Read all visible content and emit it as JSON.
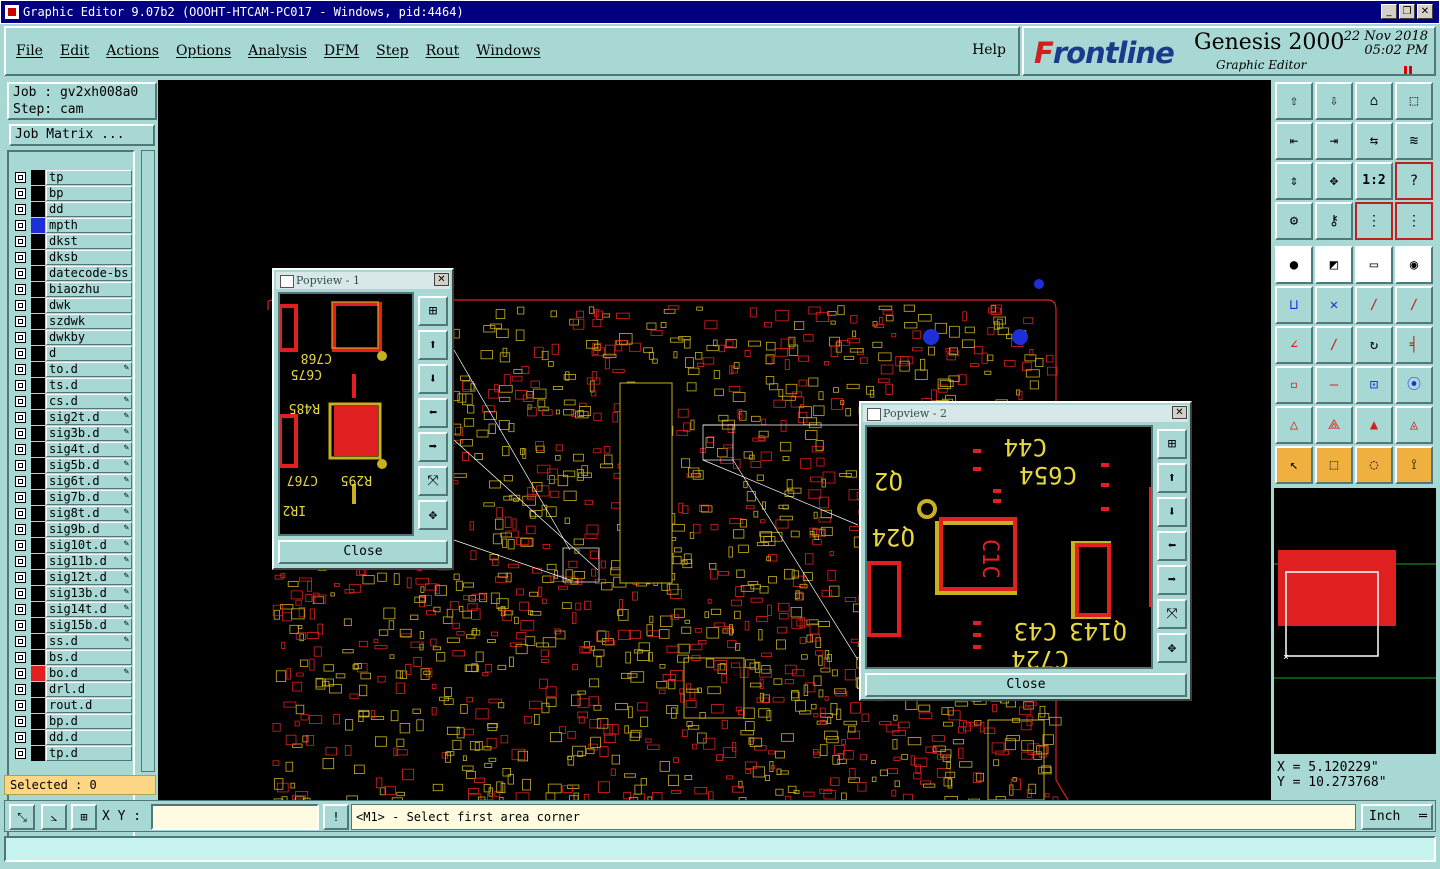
{
  "window": {
    "title": "Graphic Editor 9.07b2 (OOOHT-HTCAM-PC017 - Windows, pid:4464)"
  },
  "menu": [
    "File",
    "Edit",
    "Actions",
    "Options",
    "Analysis",
    "DFM",
    "Step",
    "Rout",
    "Windows"
  ],
  "help_label": "Help",
  "brand": {
    "logo_pre": "F",
    "logo_rest": "rontline",
    "product": "Genesis 2000",
    "subtitle": "Graphic Editor",
    "date": "22 Nov 2018",
    "time": "05:02 PM"
  },
  "job": {
    "job_line": "Job : gv2xh008a0",
    "step_line": "Step: cam",
    "matrix_label": "Job Matrix ..."
  },
  "layers": [
    {
      "name": "tp",
      "color": "#000000",
      "edit": ""
    },
    {
      "name": "bp",
      "color": "#000000",
      "edit": ""
    },
    {
      "name": "dd",
      "color": "#000000",
      "edit": ""
    },
    {
      "name": "mpth",
      "color": "#1f2fd8",
      "edit": ""
    },
    {
      "name": "dkst",
      "color": "#000000",
      "edit": ""
    },
    {
      "name": "dksb",
      "color": "#000000",
      "edit": ""
    },
    {
      "name": "datecode-bs",
      "color": "#000000",
      "edit": ""
    },
    {
      "name": "biaozhu",
      "color": "#000000",
      "edit": ""
    },
    {
      "name": "dwk",
      "color": "#000000",
      "edit": ""
    },
    {
      "name": "szdwk",
      "color": "#000000",
      "edit": ""
    },
    {
      "name": "dwkby",
      "color": "#000000",
      "edit": ""
    },
    {
      "name": "d",
      "color": "#000000",
      "edit": ""
    },
    {
      "name": "to.d",
      "color": "#000000",
      "edit": "✎"
    },
    {
      "name": "ts.d",
      "color": "#000000",
      "edit": ""
    },
    {
      "name": "cs.d",
      "color": "#000000",
      "edit": "✎"
    },
    {
      "name": "sig2t.d",
      "color": "#000000",
      "edit": "✎"
    },
    {
      "name": "sig3b.d",
      "color": "#000000",
      "edit": "✎"
    },
    {
      "name": "sig4t.d",
      "color": "#000000",
      "edit": "✎"
    },
    {
      "name": "sig5b.d",
      "color": "#000000",
      "edit": "✎"
    },
    {
      "name": "sig6t.d",
      "color": "#000000",
      "edit": "✎"
    },
    {
      "name": "sig7b.d",
      "color": "#000000",
      "edit": "✎"
    },
    {
      "name": "sig8t.d",
      "color": "#000000",
      "edit": "✎"
    },
    {
      "name": "sig9b.d",
      "color": "#000000",
      "edit": "✎"
    },
    {
      "name": "sig10t.d",
      "color": "#000000",
      "edit": "✎"
    },
    {
      "name": "sig11b.d",
      "color": "#000000",
      "edit": "✎"
    },
    {
      "name": "sig12t.d",
      "color": "#000000",
      "edit": "✎"
    },
    {
      "name": "sig13b.d",
      "color": "#000000",
      "edit": "✎"
    },
    {
      "name": "sig14t.d",
      "color": "#000000",
      "edit": "✎"
    },
    {
      "name": "sig15b.d",
      "color": "#000000",
      "edit": "✎"
    },
    {
      "name": "ss.d",
      "color": "#000000",
      "edit": "✎"
    },
    {
      "name": "bs.d",
      "color": "#000000",
      "edit": ""
    },
    {
      "name": "bo.d",
      "color": "#e02020",
      "edit": "✎"
    },
    {
      "name": "drl.d",
      "color": "#000000",
      "edit": ""
    },
    {
      "name": "rout.d",
      "color": "#000000",
      "edit": ""
    },
    {
      "name": "bp.d",
      "color": "#000000",
      "edit": ""
    },
    {
      "name": "dd.d",
      "color": "#000000",
      "edit": ""
    },
    {
      "name": "tp.d",
      "color": "#000000",
      "edit": ""
    }
  ],
  "selected_label": "Selected : 0",
  "popview1": {
    "title": "Popview - 1",
    "close_label": "Close",
    "close_x": "✕"
  },
  "popview2": {
    "title": "Popview - 2",
    "close_label": "Close",
    "close_x": "✕"
  },
  "popview1_labels": [
    "C768",
    "C675",
    "R485",
    "R295",
    "C767",
    "IR2"
  ],
  "popview2_labels": [
    "C44",
    "C654",
    "Q2",
    "Q24",
    "C43",
    "Q143",
    "C724",
    "C1C"
  ],
  "coords": {
    "x_line": "X = 5.120229\"",
    "y_line": "Y = 10.273768\""
  },
  "xy_label": "X Y :",
  "xy_value": "",
  "message": "<M1> - Select first area corner",
  "unit_label": "Inch",
  "colors": {
    "board_outline": "#e02020",
    "trace": "#c8b020",
    "pad": "#e02020",
    "drill": "#1f2fd8"
  }
}
